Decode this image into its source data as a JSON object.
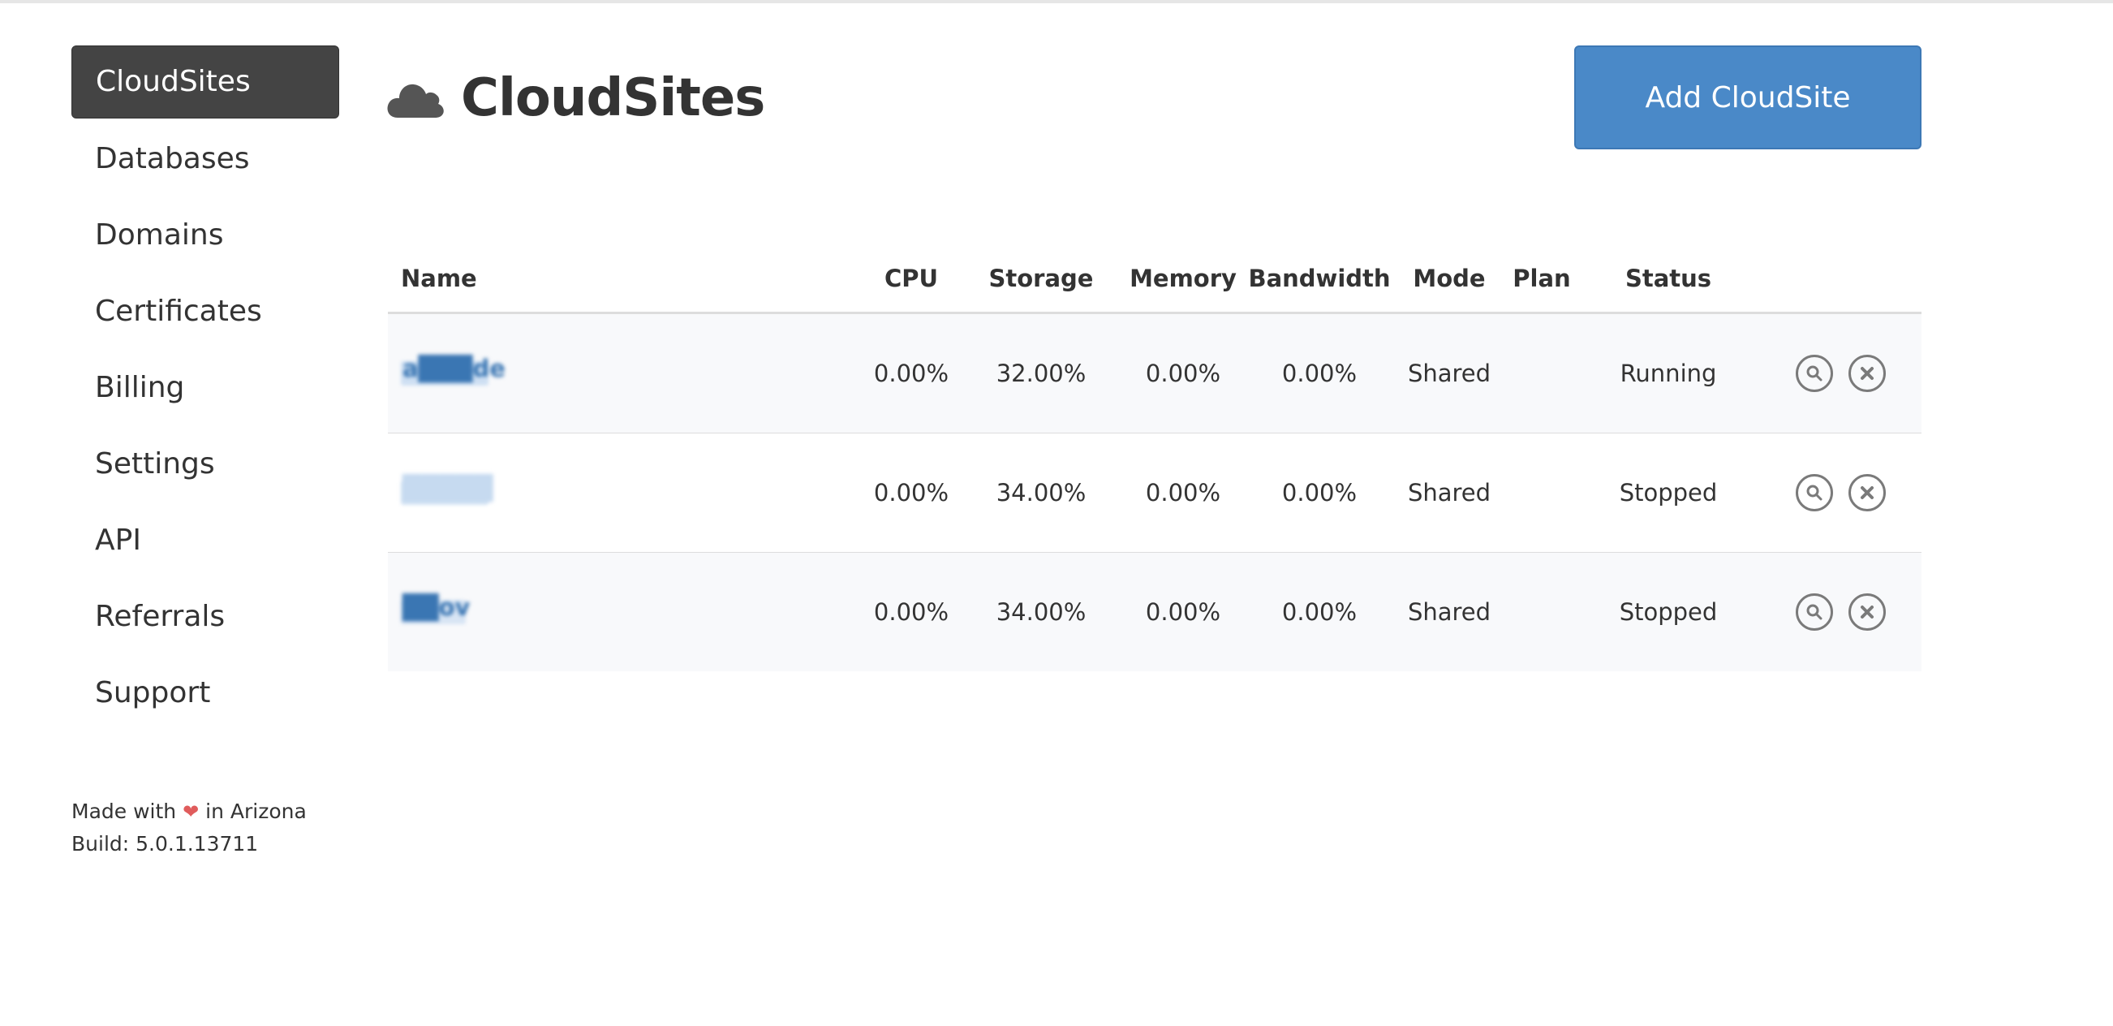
{
  "sidebar": {
    "items": [
      {
        "label": "CloudSites",
        "active": true
      },
      {
        "label": "Databases"
      },
      {
        "label": "Domains"
      },
      {
        "label": "Certificates"
      },
      {
        "label": "Billing"
      },
      {
        "label": "Settings"
      },
      {
        "label": "API"
      },
      {
        "label": "Referrals"
      },
      {
        "label": "Support"
      }
    ]
  },
  "footer": {
    "made_prefix": "Made with",
    "made_suffix": "in Arizona",
    "heart_icon": "heart-icon",
    "build": "Build: 5.0.1.13711"
  },
  "header": {
    "icon": "cloud-icon",
    "title": "CloudSites",
    "add_button": "Add CloudSite"
  },
  "table": {
    "columns": [
      "Name",
      "CPU",
      "Storage",
      "Memory",
      "Bandwidth",
      "Mode",
      "Plan",
      "Status"
    ],
    "rows": [
      {
        "name": "a███de",
        "cpu": "0.00%",
        "storage": "32.00%",
        "memory": "0.00%",
        "bandwidth": "0.00%",
        "mode": "Shared",
        "plan": "",
        "status": "Running"
      },
      {
        "name": "█████",
        "cpu": "0.00%",
        "storage": "34.00%",
        "memory": "0.00%",
        "bandwidth": "0.00%",
        "mode": "Shared",
        "plan": "",
        "status": "Stopped"
      },
      {
        "name": "██ov",
        "cpu": "0.00%",
        "storage": "34.00%",
        "memory": "0.00%",
        "bandwidth": "0.00%",
        "mode": "Shared",
        "plan": "",
        "status": "Stopped"
      }
    ],
    "row_actions": [
      "search-icon",
      "close-icon"
    ]
  },
  "colors": {
    "active_nav_bg": "#444444",
    "primary_button": "#4a89c8",
    "link": "#3a76b3",
    "heart": "#e05c5c"
  }
}
